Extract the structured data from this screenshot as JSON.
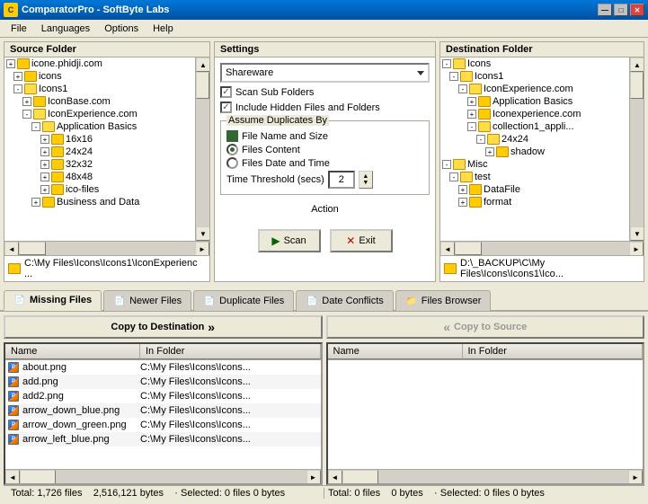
{
  "titleBar": {
    "appName": "ComparatorPro",
    "companyName": "SoftByte Labs",
    "title": "ComparatorPro - SoftByte Labs",
    "minimizeBtn": "—",
    "maximizeBtn": "□",
    "closeBtn": "✕"
  },
  "menuBar": {
    "items": [
      {
        "id": "file",
        "label": "File"
      },
      {
        "id": "languages",
        "label": "Languages"
      },
      {
        "id": "options",
        "label": "Options"
      },
      {
        "id": "help",
        "label": "Help"
      }
    ]
  },
  "sourceFolder": {
    "header": "Source Folder",
    "tree": [
      {
        "indent": 0,
        "expand": "+",
        "label": "icone.phidji.com",
        "level": 0
      },
      {
        "indent": 1,
        "expand": "+",
        "label": "icons",
        "level": 1
      },
      {
        "indent": 1,
        "expand": "-",
        "label": "Icons1",
        "level": 1
      },
      {
        "indent": 2,
        "expand": "+",
        "label": "IconBase.com",
        "level": 2
      },
      {
        "indent": 2,
        "expand": "-",
        "label": "IconExperience.com",
        "level": 2
      },
      {
        "indent": 3,
        "expand": "-",
        "label": "Application Basics",
        "level": 3
      },
      {
        "indent": 4,
        "expand": "+",
        "label": "16x16",
        "level": 4
      },
      {
        "indent": 4,
        "expand": "+",
        "label": "24x24",
        "level": 4
      },
      {
        "indent": 4,
        "expand": "+",
        "label": "32x32",
        "level": 4
      },
      {
        "indent": 4,
        "expand": "+",
        "label": "48x48",
        "level": 4
      },
      {
        "indent": 4,
        "expand": "+",
        "label": "ico-files",
        "level": 4
      },
      {
        "indent": 3,
        "expand": "+",
        "label": "Business and Data",
        "level": 3
      }
    ],
    "path": "C:\\My Files\\Icons\\Icons1\\IconExperienc ..."
  },
  "settings": {
    "header": "Settings",
    "dropdownValue": "Shareware",
    "checkboxes": [
      {
        "id": "scanSubFolders",
        "label": "Scan Sub Folders",
        "checked": true
      },
      {
        "id": "includeHidden",
        "label": "Include Hidden Files and Folders",
        "checked": true
      }
    ],
    "groupLabel": "Assume Duplicates By",
    "radios": [
      {
        "id": "fileNameSize",
        "label": "File Name and Size",
        "checked": false
      },
      {
        "id": "filesContent",
        "label": "Files Content",
        "checked": true
      },
      {
        "id": "filesDateTime",
        "label": "Files Date and Time",
        "checked": false
      }
    ],
    "thresholdLabel": "Time Threshold (secs)",
    "thresholdValue": "2",
    "actionLabel": "Action",
    "scanBtn": "Scan",
    "exitBtn": "Exit"
  },
  "destFolder": {
    "header": "Destination Folder",
    "tree": [
      {
        "indent": 0,
        "expand": "-",
        "label": "Icons",
        "level": 0
      },
      {
        "indent": 1,
        "expand": "-",
        "label": "Icons1",
        "level": 1
      },
      {
        "indent": 2,
        "expand": "-",
        "label": "IconExperience.com",
        "level": 2
      },
      {
        "indent": 3,
        "expand": "+",
        "label": "Application Basics",
        "level": 3
      },
      {
        "indent": 3,
        "expand": "+",
        "label": "Iconexperience.com",
        "level": 3
      },
      {
        "indent": 3,
        "expand": "-",
        "label": "collection1_appli...",
        "level": 3
      },
      {
        "indent": 4,
        "expand": "+",
        "label": "24x24",
        "level": 4
      },
      {
        "indent": 5,
        "expand": "+",
        "label": "shadow",
        "level": 5
      },
      {
        "indent": 0,
        "expand": "-",
        "label": "Misc",
        "level": 0
      },
      {
        "indent": 1,
        "expand": "-",
        "label": "test",
        "level": 1
      },
      {
        "indent": 2,
        "expand": "+",
        "label": "DataFile",
        "level": 2
      },
      {
        "indent": 2,
        "expand": "+",
        "label": "format",
        "level": 2
      }
    ],
    "path": "D:\\_BACKUP\\C\\My Files\\Icons\\Icons1\\Ico..."
  },
  "tabs": [
    {
      "id": "missing",
      "label": "Missing Files",
      "icon": "📄",
      "active": true
    },
    {
      "id": "newer",
      "label": "Newer Files",
      "icon": "📄",
      "active": false
    },
    {
      "id": "duplicate",
      "label": "Duplicate Files",
      "icon": "📄",
      "active": false
    },
    {
      "id": "dateConflicts",
      "label": "Date Conflicts",
      "icon": "📄",
      "active": false
    },
    {
      "id": "filesBrowser",
      "label": "Files Browser",
      "icon": "📁",
      "active": false
    }
  ],
  "copyButtons": {
    "copyToDestination": "Copy to Destination",
    "copyToSource": "Copy to Source"
  },
  "leftPanel": {
    "columns": [
      {
        "id": "name",
        "label": "Name"
      },
      {
        "id": "folder",
        "label": "In Folder"
      }
    ],
    "files": [
      {
        "name": "about.png",
        "folder": "C:\\My Files\\Icons\\Icons..."
      },
      {
        "name": "add.png",
        "folder": "C:\\My Files\\Icons\\Icons..."
      },
      {
        "name": "add2.png",
        "folder": "C:\\My Files\\Icons\\Icons..."
      },
      {
        "name": "arrow_down_blue.png",
        "folder": "C:\\My Files\\Icons\\Icons..."
      },
      {
        "name": "arrow_down_green.png",
        "folder": "C:\\My Files\\Icons\\Icons..."
      },
      {
        "name": "arrow_left_blue.png",
        "folder": "C:\\My Files\\Icons\\Icons..."
      }
    ],
    "statusTotal": "Total: 1,726 files",
    "statusBytes": "2,516,121 bytes",
    "statusSelected": "· Selected: 0 files  0 bytes"
  },
  "rightPanel": {
    "columns": [
      {
        "id": "name",
        "label": "Name"
      },
      {
        "id": "folder",
        "label": "In Folder"
      }
    ],
    "files": [],
    "statusTotal": "Total: 0 files",
    "statusBytes": "0 bytes",
    "statusSelected": "· Selected: 0 files  0 bytes"
  }
}
